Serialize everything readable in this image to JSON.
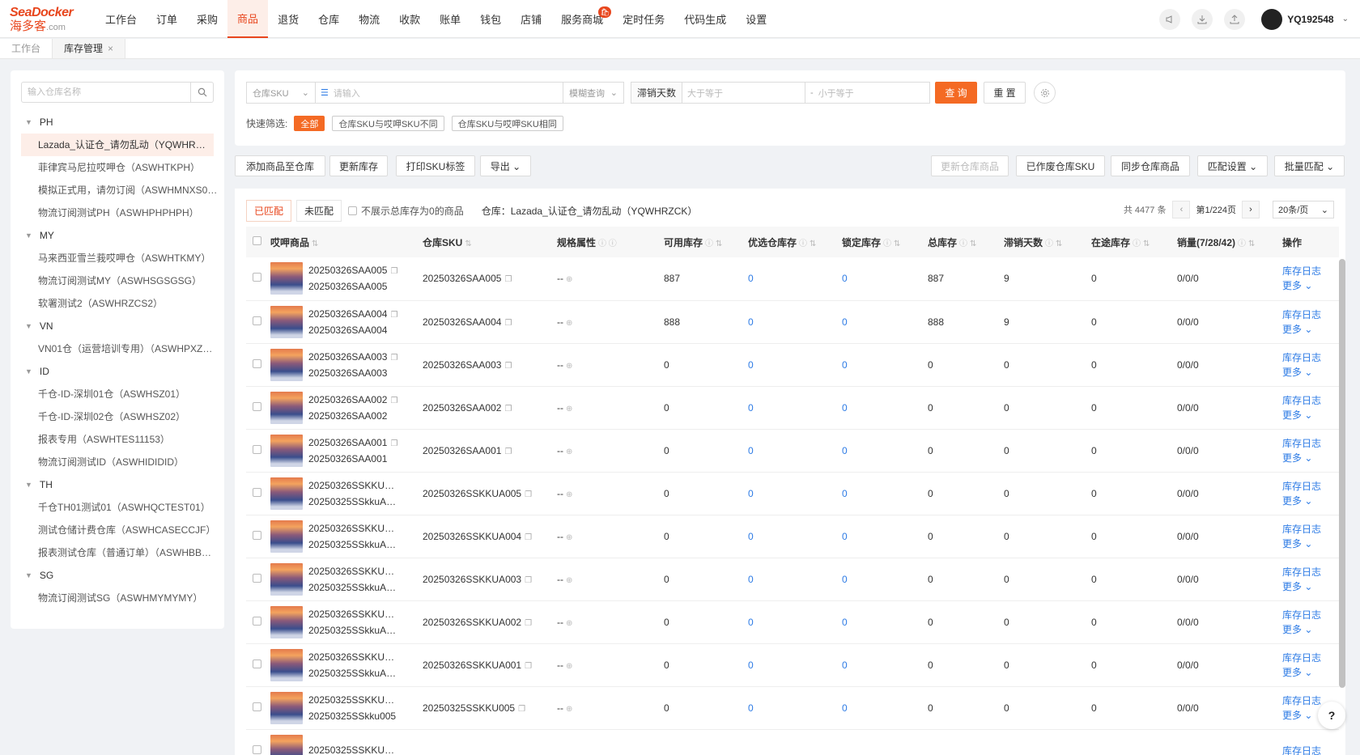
{
  "logo": {
    "brand": "SeaDocker",
    "cn": "海多客",
    "domain": ".com"
  },
  "nav": [
    {
      "label": "工作台"
    },
    {
      "label": "订单"
    },
    {
      "label": "采购"
    },
    {
      "label": "商品",
      "active": true
    },
    {
      "label": "退货"
    },
    {
      "label": "仓库"
    },
    {
      "label": "物流"
    },
    {
      "label": "收款"
    },
    {
      "label": "账单"
    },
    {
      "label": "钱包"
    },
    {
      "label": "店铺"
    },
    {
      "label": "服务商城",
      "badge": "🛍"
    },
    {
      "label": "定时任务"
    },
    {
      "label": "代码生成"
    },
    {
      "label": "设置"
    }
  ],
  "user": {
    "name": "YQ192548"
  },
  "tabs": [
    {
      "label": "工作台"
    },
    {
      "label": "库存管理",
      "close": "×"
    }
  ],
  "sidebar": {
    "search_placeholder": "输入仓库名称",
    "groups": [
      {
        "name": "PH",
        "items": [
          "Lazada_认证仓_请勿乱动（YQWHRZCK）",
          "菲律宾马尼拉哎呷仓（ASWHTKPH）",
          "模拟正式用，请勿订阅（ASWHMNXS0…",
          "物流订阅测试PH（ASWHPHPHPH）"
        ]
      },
      {
        "name": "MY",
        "items": [
          "马来西亚雪兰莪哎呷仓（ASWHTKMY）",
          "物流订阅测试MY（ASWHSGSGSG）",
          "软署测试2（ASWHRZCS2）"
        ]
      },
      {
        "name": "VN",
        "items": [
          "VN01仓（运营培训专用）（ASWHPXZ…"
        ]
      },
      {
        "name": "ID",
        "items": [
          "千仓-ID-深圳01仓（ASWHSZ01）",
          "千仓-ID-深圳02仓（ASWHSZ02）",
          "报表专用（ASWHTES11153）",
          "物流订阅测试ID（ASWHIDIDID）"
        ]
      },
      {
        "name": "TH",
        "items": [
          "千仓TH01测试01（ASWHQCTEST01）",
          "测试仓储计费仓库（ASWHCASECCJF）",
          "报表测试仓库（普通订单）（ASWHBB…"
        ]
      },
      {
        "name": "SG",
        "items": [
          "物流订阅测试SG（ASWHMYMYMY）"
        ]
      }
    ]
  },
  "filter": {
    "sku_select": "仓库SKU",
    "input_placeholder": "请输入",
    "match_select": "模糊查询",
    "days_label": "滞销天数",
    "min_placeholder": "大于等于",
    "dash": "-",
    "max_placeholder": "小于等于",
    "query": "查 询",
    "reset": "重 置",
    "quick_label": "快速筛选:",
    "chips": [
      "全部",
      "仓库SKU与哎呷SKU不同",
      "仓库SKU与哎呷SKU相同"
    ]
  },
  "actions": {
    "add": "添加商品至仓库",
    "update": "更新库存",
    "print": "打印SKU标签",
    "export": "导出 ⌄",
    "update_goods": "更新仓库商品",
    "discarded": "已作废仓库SKU",
    "sync": "同步仓库商品",
    "match_settings": "匹配设置 ⌄",
    "batch_match": "批量匹配 ⌄"
  },
  "table_panel": {
    "tab_matched": "已匹配",
    "tab_unmatched": "未匹配",
    "hide_zero": "不展示总库存为0的商品",
    "warehouse": "仓库：Lazada_认证仓_请勿乱动（YQWHRZCK）",
    "total": "共 4477 条",
    "page": "第1/224页",
    "page_size": "20条/页"
  },
  "columns": [
    "哎呷商品",
    "仓库SKU",
    "规格属性",
    "可用库存",
    "优选仓库存",
    "锁定库存",
    "总库存",
    "滞销天数",
    "在途库存",
    "销量(7/28/42)",
    "操作"
  ],
  "rows": [
    {
      "n1": "20250326SAA005",
      "n2": "20250326SAA005",
      "sku": "20250326SAA005",
      "spec": "--",
      "avail": "887",
      "pref": "0",
      "lock": "0",
      "total": "887",
      "days": "9",
      "transit": "0",
      "sales": "0/0/0",
      "op1": "库存日志",
      "op2": "更多 ⌄"
    },
    {
      "n1": "20250326SAA004",
      "n2": "20250326SAA004",
      "sku": "20250326SAA004",
      "spec": "--",
      "avail": "888",
      "pref": "0",
      "lock": "0",
      "total": "888",
      "days": "9",
      "transit": "0",
      "sales": "0/0/0",
      "op1": "库存日志",
      "op2": "更多 ⌄"
    },
    {
      "n1": "20250326SAA003",
      "n2": "20250326SAA003",
      "sku": "20250326SAA003",
      "spec": "--",
      "avail": "0",
      "pref": "0",
      "lock": "0",
      "total": "0",
      "days": "0",
      "transit": "0",
      "sales": "0/0/0",
      "op1": "库存日志",
      "op2": "更多 ⌄"
    },
    {
      "n1": "20250326SAA002",
      "n2": "20250326SAA002",
      "sku": "20250326SAA002",
      "spec": "--",
      "avail": "0",
      "pref": "0",
      "lock": "0",
      "total": "0",
      "days": "0",
      "transit": "0",
      "sales": "0/0/0",
      "op1": "库存日志",
      "op2": "更多 ⌄"
    },
    {
      "n1": "20250326SAA001",
      "n2": "20250326SAA001",
      "sku": "20250326SAA001",
      "spec": "--",
      "avail": "0",
      "pref": "0",
      "lock": "0",
      "total": "0",
      "days": "0",
      "transit": "0",
      "sales": "0/0/0",
      "op1": "库存日志",
      "op2": "更多 ⌄"
    },
    {
      "n1": "20250326SSKKU…",
      "n2": "20250325SSkkuA005",
      "sku": "20250326SSKKUA005",
      "spec": "--",
      "avail": "0",
      "pref": "0",
      "lock": "0",
      "total": "0",
      "days": "0",
      "transit": "0",
      "sales": "0/0/0",
      "op1": "库存日志",
      "op2": "更多 ⌄"
    },
    {
      "n1": "20250326SSKKU…",
      "n2": "20250325SSkkuA004",
      "sku": "20250326SSKKUA004",
      "spec": "--",
      "avail": "0",
      "pref": "0",
      "lock": "0",
      "total": "0",
      "days": "0",
      "transit": "0",
      "sales": "0/0/0",
      "op1": "库存日志",
      "op2": "更多 ⌄"
    },
    {
      "n1": "20250326SSKKU…",
      "n2": "20250325SSkkuA003",
      "sku": "20250326SSKKUA003",
      "spec": "--",
      "avail": "0",
      "pref": "0",
      "lock": "0",
      "total": "0",
      "days": "0",
      "transit": "0",
      "sales": "0/0/0",
      "op1": "库存日志",
      "op2": "更多 ⌄"
    },
    {
      "n1": "20250326SSKKU…",
      "n2": "20250325SSkkuA002",
      "sku": "20250326SSKKUA002",
      "spec": "--",
      "avail": "0",
      "pref": "0",
      "lock": "0",
      "total": "0",
      "days": "0",
      "transit": "0",
      "sales": "0/0/0",
      "op1": "库存日志",
      "op2": "更多 ⌄"
    },
    {
      "n1": "20250326SSKKU…",
      "n2": "20250325SSkkuA001",
      "sku": "20250326SSKKUA001",
      "spec": "--",
      "avail": "0",
      "pref": "0",
      "lock": "0",
      "total": "0",
      "days": "0",
      "transit": "0",
      "sales": "0/0/0",
      "op1": "库存日志",
      "op2": "更多 ⌄"
    },
    {
      "n1": "20250325SSKKU…",
      "n2": "20250325SSkku005",
      "sku": "20250325SSKKU005",
      "spec": "--",
      "avail": "0",
      "pref": "0",
      "lock": "0",
      "total": "0",
      "days": "0",
      "transit": "0",
      "sales": "0/0/0",
      "op1": "库存日志",
      "op2": "更多 ⌄"
    },
    {
      "n1": "20250325SSKKU…",
      "n2": "",
      "sku": "",
      "spec": "",
      "avail": "",
      "pref": "",
      "lock": "",
      "total": "",
      "days": "",
      "transit": "",
      "sales": "",
      "op1": "库存日志",
      "op2": ""
    }
  ],
  "help": "?"
}
